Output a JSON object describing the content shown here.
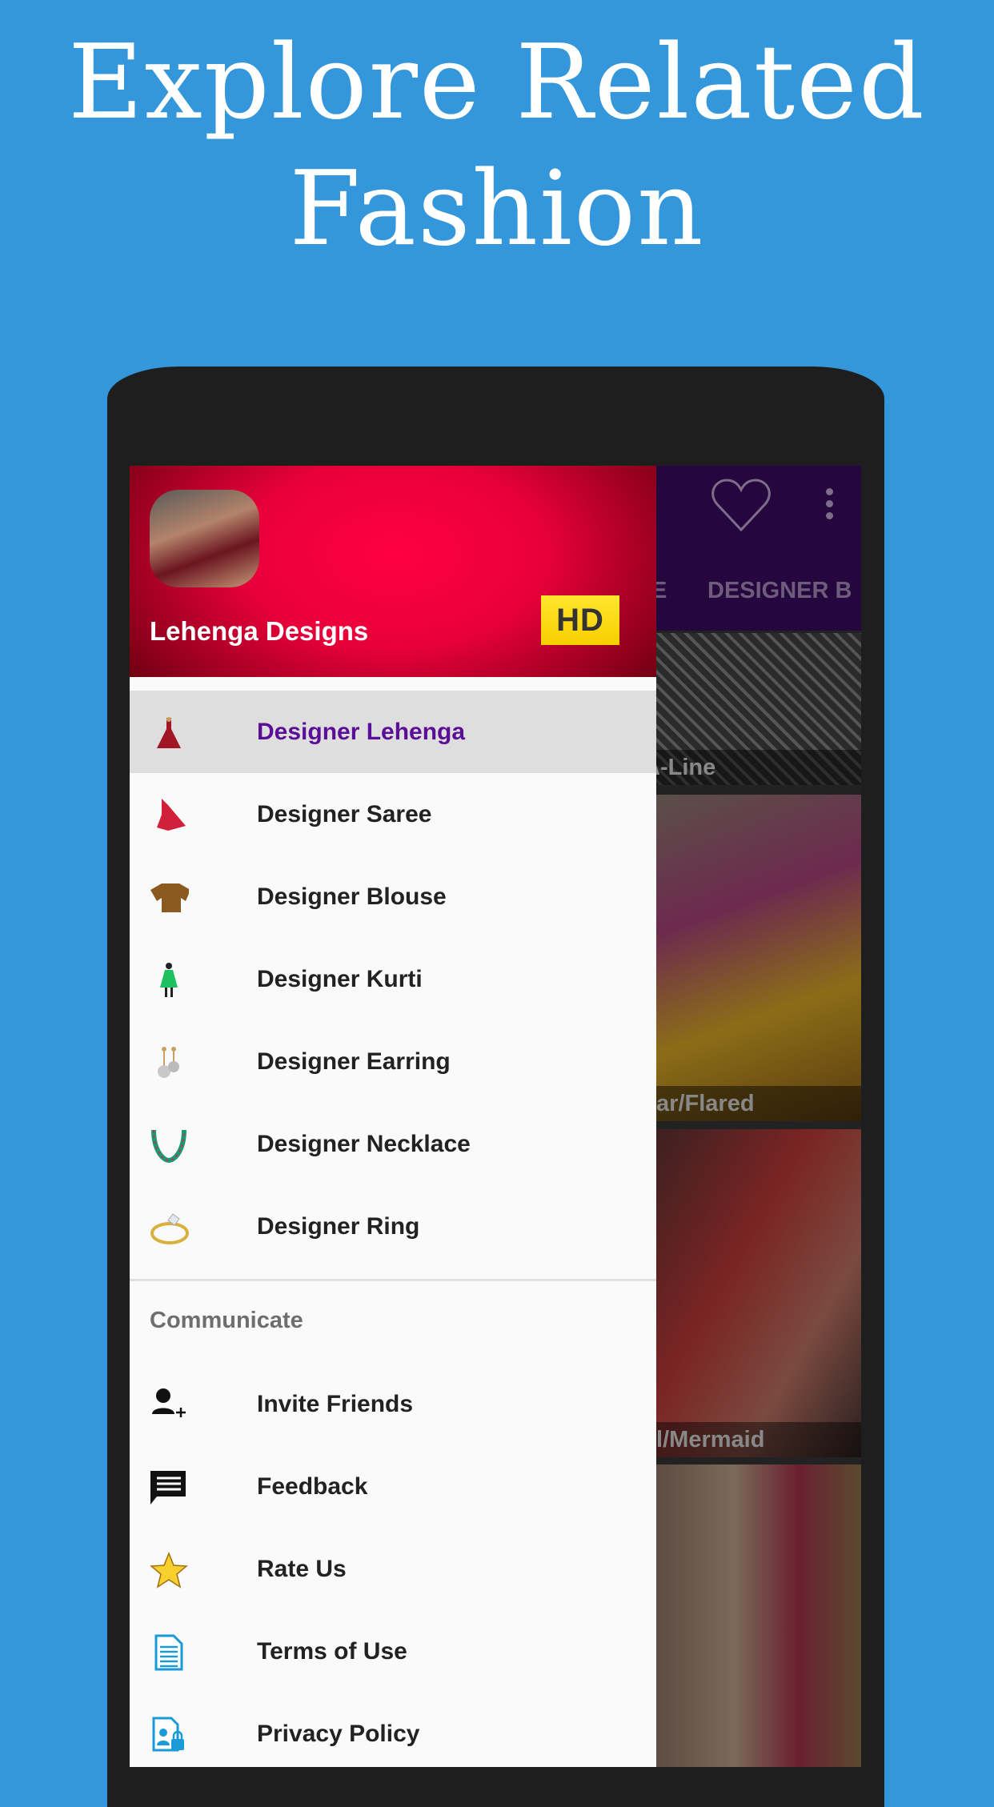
{
  "headline": {
    "line1": "Explore Related",
    "line2": "Fashion"
  },
  "app": {
    "toolbar": {
      "tabs": [
        "E",
        "DESIGNER B"
      ],
      "icons": [
        "heart-icon",
        "more-vert-icon"
      ],
      "color": "#25063f"
    },
    "grid": [
      {
        "label": "A-Line"
      },
      {
        "label": "lar/Flared"
      },
      {
        "label": "il/Mermaid"
      },
      {
        "label": ""
      }
    ],
    "drawer": {
      "title": "Lehenga Designs",
      "badge": "HD",
      "items": [
        {
          "label": "Designer Lehenga",
          "icon": "lehenga-icon",
          "selected": true
        },
        {
          "label": "Designer Saree",
          "icon": "saree-icon"
        },
        {
          "label": "Designer Blouse",
          "icon": "blouse-icon"
        },
        {
          "label": "Designer Kurti",
          "icon": "kurti-icon"
        },
        {
          "label": "Designer Earring",
          "icon": "earring-icon"
        },
        {
          "label": "Designer Necklace",
          "icon": "necklace-icon"
        },
        {
          "label": "Designer Ring",
          "icon": "ring-icon"
        }
      ],
      "section": "Communicate",
      "comm": [
        {
          "label": "Invite Friends",
          "icon": "add-person-icon"
        },
        {
          "label": "Feedback",
          "icon": "feedback-icon"
        },
        {
          "label": "Rate Us",
          "icon": "star-icon"
        },
        {
          "label": "Terms of Use",
          "icon": "document-icon"
        },
        {
          "label": "Privacy Policy",
          "icon": "privacy-icon"
        }
      ],
      "accent": "#5b0e96"
    }
  }
}
